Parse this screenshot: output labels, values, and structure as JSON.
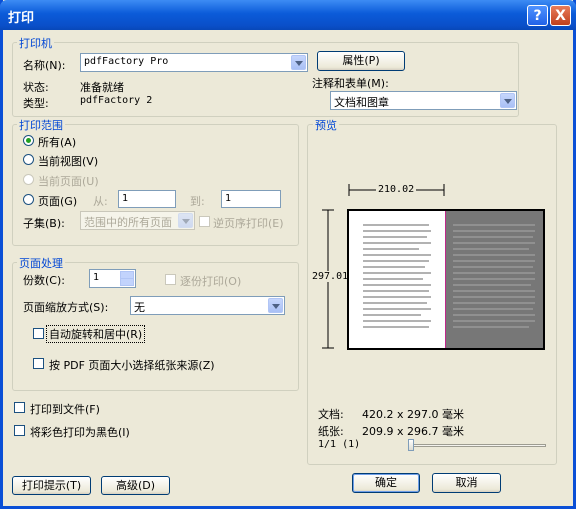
{
  "window": {
    "title": "打印"
  },
  "title_buttons": {
    "help": "?",
    "close": "X"
  },
  "printer": {
    "group_label": "打印机",
    "name_label": "名称(N):",
    "name_value": "pdfFactory Pro",
    "properties_button": "属性(P)",
    "status_label": "状态:",
    "status_value": "准备就绪",
    "type_label": "类型:",
    "type_value": "pdfFactory 2",
    "comments_label": "注释和表单(M):",
    "comments_value": "文档和图章"
  },
  "range": {
    "group_label": "打印范围",
    "all": "所有(A)",
    "current_view": "当前视图(V)",
    "current_page": "当前页面(U)",
    "pages": "页面(G)",
    "from_label": "从:",
    "from_value": "1",
    "to_label": "到:",
    "to_value": "1",
    "subset_label": "子集(B):",
    "subset_value": "范围中的所有页面",
    "reverse": "逆页序打印(E)"
  },
  "handling": {
    "group_label": "页面处理",
    "copies_label": "份数(C):",
    "copies_value": "1",
    "collate": "逐份打印(O)",
    "scaling_label": "页面缩放方式(S):",
    "scaling_value": "无",
    "auto_rotate": "自动旋转和居中(R)",
    "pdf_page_size": "按 PDF 页面大小选择纸张来源(Z)"
  },
  "options": {
    "print_to_file": "打印到文件(F)",
    "print_color_as_black": "将彩色打印为黑色(I)"
  },
  "preview": {
    "group_label": "预览",
    "width_value": "210.02",
    "height_value": "297.01",
    "document_label": "文档:",
    "document_value": "420.2 x 297.0 毫米",
    "paper_label": "纸张:",
    "paper_value": "209.9 x 296.7 毫米",
    "page_indicator": "1/1 (1)"
  },
  "buttons": {
    "print_tips": "打印提示(T)",
    "advanced": "高级(D)",
    "ok": "确定",
    "cancel": "取消"
  }
}
